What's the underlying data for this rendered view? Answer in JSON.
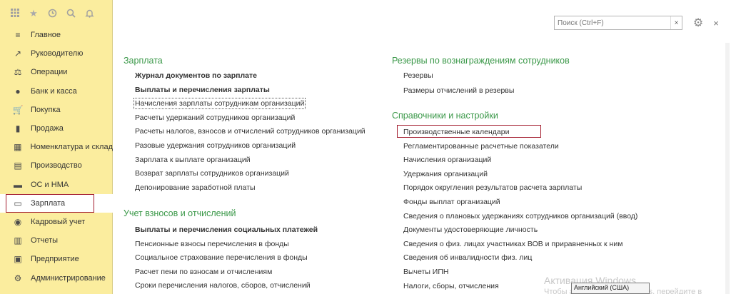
{
  "topbar": {
    "icons": [
      "apps-grid-icon",
      "star-icon",
      "history-icon",
      "search-icon",
      "bell-icon"
    ]
  },
  "sidebar": {
    "items": [
      {
        "label": "Главное",
        "icon": "menu-lines-icon"
      },
      {
        "label": "Руководителю",
        "icon": "trend-chart-icon"
      },
      {
        "label": "Операции",
        "icon": "operations-icon"
      },
      {
        "label": "Банк и касса",
        "icon": "coins-icon"
      },
      {
        "label": "Покупка",
        "icon": "cart-icon"
      },
      {
        "label": "Продажа",
        "icon": "bag-icon"
      },
      {
        "label": "Номенклатура и склад",
        "icon": "warehouse-icon"
      },
      {
        "label": "Производство",
        "icon": "factory-icon"
      },
      {
        "label": "ОС и НМА",
        "icon": "truck-icon"
      },
      {
        "label": "Зарплата",
        "icon": "wallet-icon"
      },
      {
        "label": "Кадровый учет",
        "icon": "person-icon"
      },
      {
        "label": "Отчеты",
        "icon": "chart-bars-icon"
      },
      {
        "label": "Предприятие",
        "icon": "building-icon"
      },
      {
        "label": "Администрирование",
        "icon": "gear-icon"
      }
    ],
    "active_index": 9
  },
  "search": {
    "placeholder": "Поиск (Ctrl+F)",
    "clear_label": "×"
  },
  "header_controls": {
    "gear_label": "⚙",
    "close_label": "×"
  },
  "left_column": {
    "section1_title": "Зарплата",
    "section1_links": [
      {
        "label": "Журнал документов по зарплате",
        "bold": true
      },
      {
        "label": "Выплаты и перечисления зарплаты",
        "bold": true
      },
      {
        "label": "Начисления зарплаты сотрудникам организаций",
        "bold": false
      },
      {
        "label": "Расчеты удержаний сотрудников организаций",
        "bold": false
      },
      {
        "label": "Расчеты налогов, взносов и отчислений сотрудников организаций",
        "bold": false
      },
      {
        "label": "Разовые удержания сотрудников организаций",
        "bold": false
      },
      {
        "label": "Зарплата к выплате организаций",
        "bold": false
      },
      {
        "label": "Возврат зарплаты сотрудников организаций",
        "bold": false
      },
      {
        "label": "Депонирование заработной платы",
        "bold": false
      }
    ],
    "section2_title": "Учет взносов и отчислений",
    "section2_links": [
      {
        "label": "Выплаты и перечисления социальных платежей",
        "bold": true
      },
      {
        "label": "Пенсионные взносы перечисления в фонды",
        "bold": false
      },
      {
        "label": "Социальное страхование перечисления в фонды",
        "bold": false
      },
      {
        "label": "Расчет пени по взносам и отчислениям",
        "bold": false
      },
      {
        "label": "Сроки перечисления налогов, сборов, отчислений",
        "bold": false
      }
    ]
  },
  "right_column": {
    "section1_title": "Резервы по вознаграждениям сотрудников",
    "section1_links": [
      {
        "label": "Резервы"
      },
      {
        "label": "Размеры отчислений в резервы"
      }
    ],
    "section2_title": "Справочники и настройки",
    "section2_links": [
      {
        "label": "Производственные календари"
      },
      {
        "label": "Регламентированные расчетные показатели"
      },
      {
        "label": "Начисления организаций"
      },
      {
        "label": "Удержания организаций"
      },
      {
        "label": "Порядок округления результатов расчета зарплаты"
      },
      {
        "label": "Фонды выплат организаций"
      },
      {
        "label": "Сведения о плановых удержаниях сотрудников организаций (ввод)"
      },
      {
        "label": "Документы удостоверяющие личность"
      },
      {
        "label": "Сведения о физ. лицах участниках ВОВ и приравненных к ним"
      },
      {
        "label": "Сведения об инвалидности физ. лиц"
      },
      {
        "label": "Вычеты ИПН"
      },
      {
        "label": "Налоги, сборы, отчисления"
      }
    ]
  },
  "watermark": {
    "line1": "Активация Windows",
    "line2": "Чтобы активировать Windows, перейдите в"
  },
  "tooltip": {
    "text": "Английский (США)"
  },
  "colors": {
    "sidebar_bg": "#fbed9e",
    "section_title": "#3a9848",
    "highlight": "#a31c2e"
  }
}
